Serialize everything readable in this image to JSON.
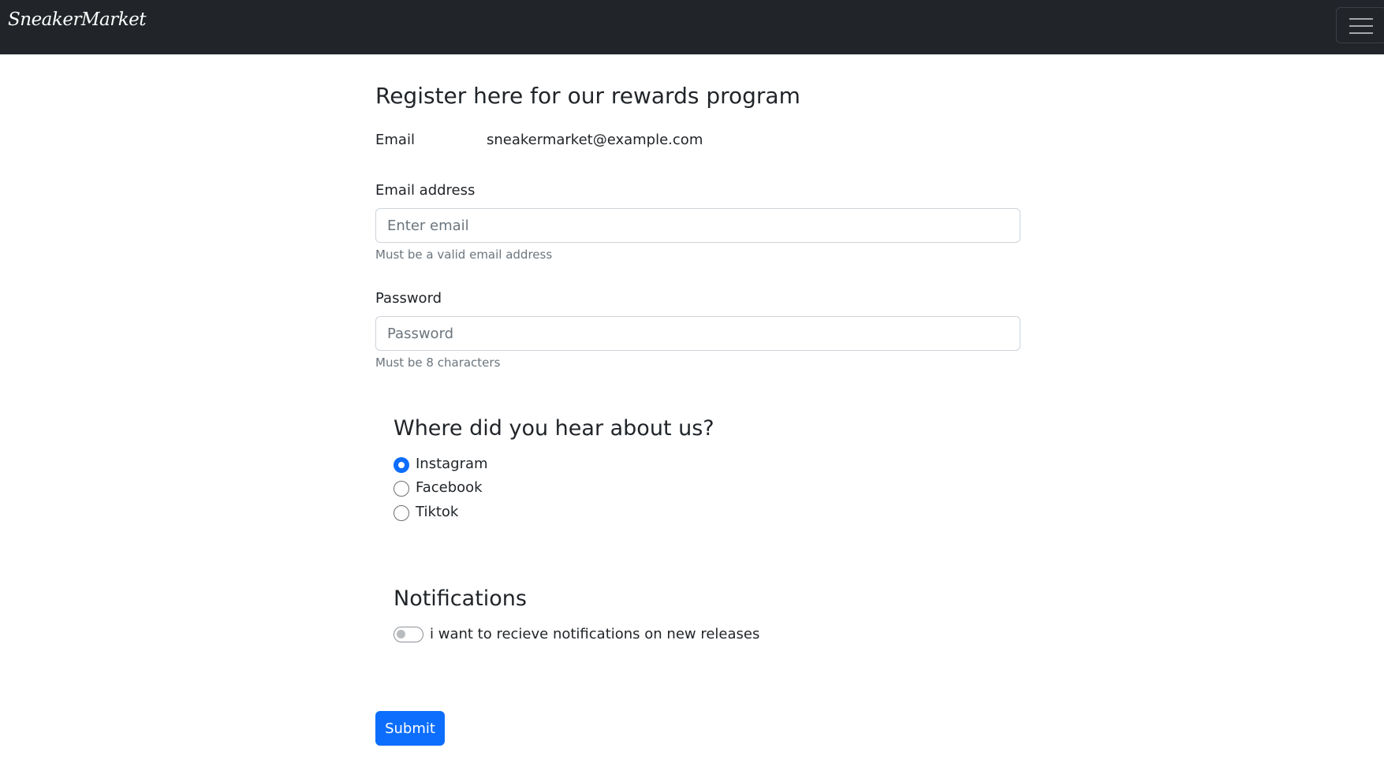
{
  "navbar": {
    "brand": "SneakerMarket",
    "menu_icon": "hamburger-menu-icon"
  },
  "form": {
    "title": "Register here for our rewards program",
    "static_email": {
      "label": "Email",
      "value": "sneakermarket@example.com"
    },
    "email": {
      "label": "Email address",
      "value": "",
      "placeholder": "Enter email",
      "help": "Must be a valid email address"
    },
    "password": {
      "label": "Password",
      "value": "",
      "placeholder": "Password",
      "help": "Must be 8 characters"
    },
    "source": {
      "title": "Where did you hear about us?",
      "options": [
        {
          "label": "Instagram",
          "checked": true
        },
        {
          "label": "Facebook",
          "checked": false
        },
        {
          "label": "Tiktok",
          "checked": false
        }
      ]
    },
    "notifications": {
      "title": "Notifications",
      "toggle_label": "i want to recieve notifications on new releases",
      "enabled": false
    },
    "submit_label": "Submit"
  },
  "colors": {
    "navbar_bg": "#212529",
    "primary": "#0d6efd",
    "muted_text": "#6c757d",
    "input_border": "#ced4da"
  }
}
